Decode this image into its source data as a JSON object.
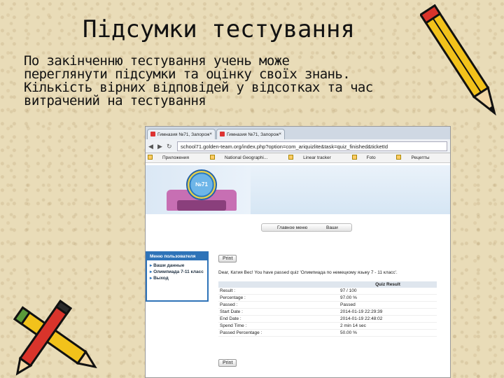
{
  "slide": {
    "title": "Підсумки тестування",
    "lines": [
      "По закінченню тестування учень може",
      "переглянути підсумки та оцінку своїх знань.",
      "Кількість вірних відповідей у відсотках та час",
      "витрачений на тестування"
    ]
  },
  "browser": {
    "tabs": [
      "Гимназия №71, Запорож",
      "Гимназия №71, Запорож"
    ],
    "url": "school71.golden-team.org/index.php?option=com_ariquizlite&task=quiz_finished&ticketId",
    "bookmarks": [
      "Приложения",
      "National Geographi...",
      "Linear tracker",
      "Foto",
      "Рецепты"
    ],
    "logo_text": "№71",
    "nav": [
      "Главное меню",
      "Ваши"
    ],
    "sidebar": {
      "title": "Меню пользователя",
      "items": [
        "Ваши данные",
        "Олимпиада 7-11 класс",
        "Выход"
      ]
    },
    "print_label": "Print",
    "result_message": "Dear, Катия Вес! You have passed quiz 'Олимпиада по немецкому языку 7 - 11 класс'.",
    "table_header": "Quiz Result",
    "results": [
      {
        "label": "Result :",
        "value": "97 / 100"
      },
      {
        "label": "Percentage :",
        "value": "97.00 %"
      },
      {
        "label": "Passed :",
        "value": "Passed"
      },
      {
        "label": "Start Date :",
        "value": "2014-01-19 22:29:39"
      },
      {
        "label": "End Date :",
        "value": "2014-01-19 22:48:02"
      },
      {
        "label": "Spend Time :",
        "value": "2 min 14 sec"
      },
      {
        "label": "Passed Percentage :",
        "value": "50.00 %"
      }
    ]
  },
  "colors": {
    "paper": "#e9dcb8",
    "sidebar_blue": "#2e73b8",
    "pencil_yellow": "#f2c21b",
    "pencil_red": "#d9342b"
  }
}
